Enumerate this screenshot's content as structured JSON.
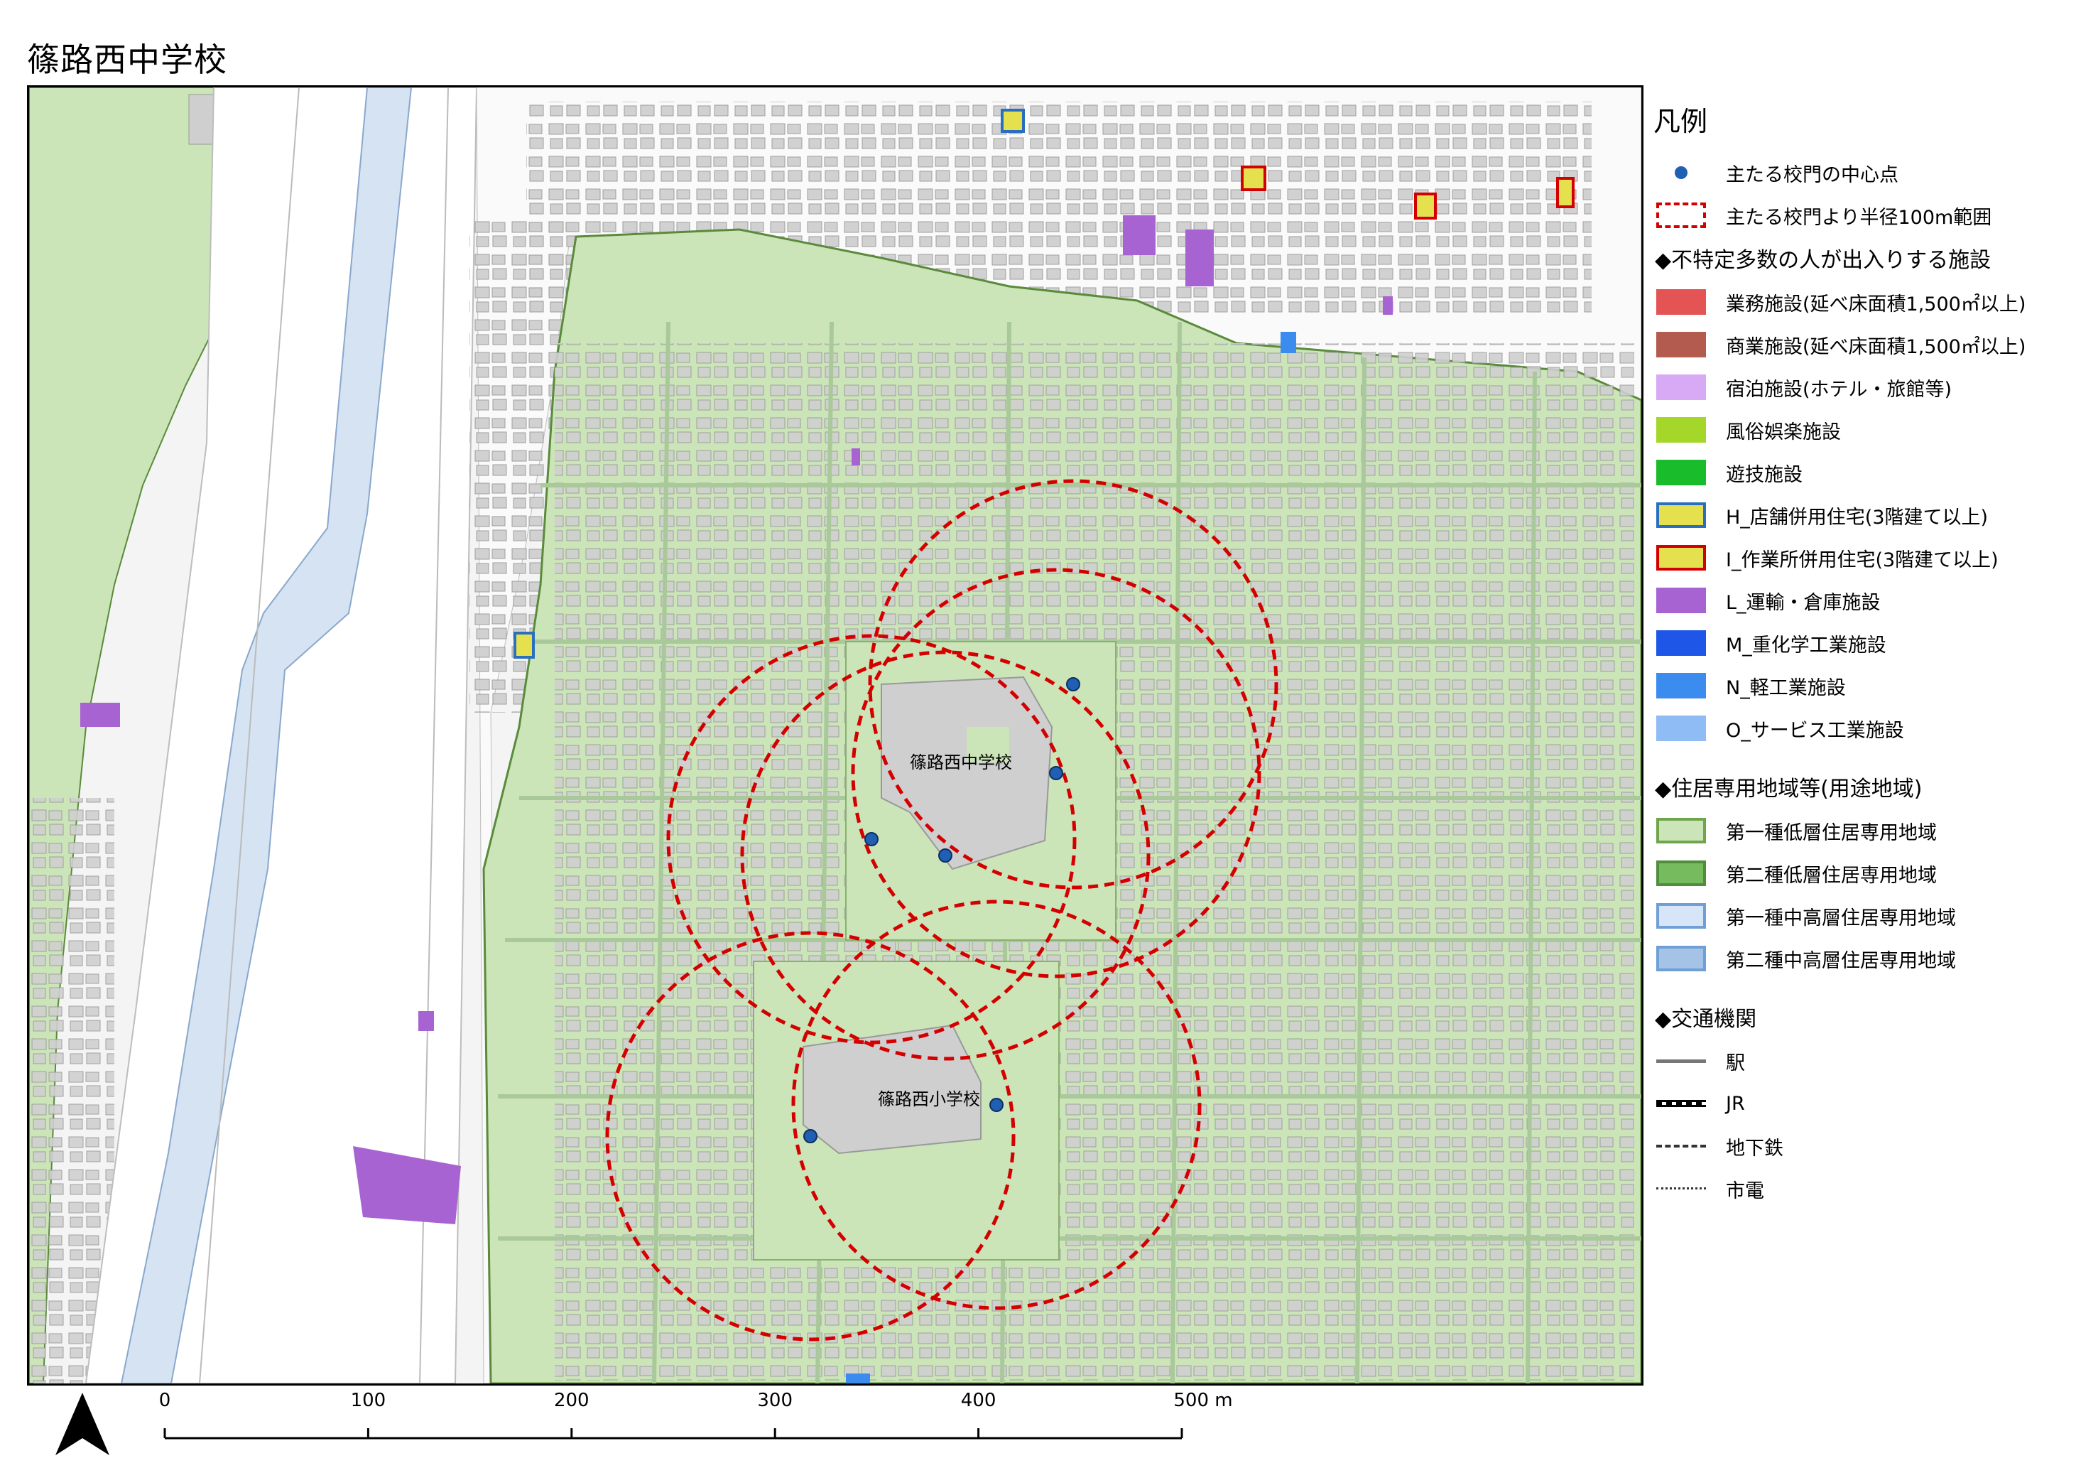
{
  "title": "篠路西中学校",
  "map": {
    "labels": {
      "middle_school": "篠路西中学校",
      "elementary_school": "篠路西小学校"
    },
    "gates": [
      {
        "school": "篠路西中学校",
        "count": 4
      },
      {
        "school": "篠路西小学校",
        "count": 2
      }
    ],
    "radius_m": 100
  },
  "legend": {
    "title": "凡例",
    "items_top": [
      {
        "label": "主たる校門の中心点",
        "symbol": "dot",
        "color": "#1f5fb4"
      },
      {
        "label": "主たる校門より半径100m範囲",
        "symbol": "dashed-rect",
        "color": "#d40000"
      }
    ],
    "facilities_header": "◆不特定多数の人が出入りする施設",
    "facilities": [
      {
        "label": "業務施設(延べ床面積1,500㎡以上)",
        "fill": "#e45454",
        "stroke": "#e45454"
      },
      {
        "label": "商業施設(延べ床面積1,500㎡以上)",
        "fill": "#b35b4f",
        "stroke": "#b35b4f"
      },
      {
        "label": "宿泊施設(ホテル・旅館等)",
        "fill": "#d8a9f4",
        "stroke": "#d8a9f4"
      },
      {
        "label": "風俗娯楽施設",
        "fill": "#a5d62a",
        "stroke": "#a5d62a"
      },
      {
        "label": "遊技施設",
        "fill": "#19bd2b",
        "stroke": "#19bd2b"
      },
      {
        "label": "H_店舗併用住宅(3階建て以上)",
        "fill": "#e4e04e",
        "stroke": "#2a6fbf"
      },
      {
        "label": "I_作業所併用住宅(3階建て以上)",
        "fill": "#e4e04e",
        "stroke": "#d40000"
      },
      {
        "label": "L_運輸・倉庫施設",
        "fill": "#a863d2",
        "stroke": "#a863d2"
      },
      {
        "label": "M_重化学工業施設",
        "fill": "#1e56e8",
        "stroke": "#1e56e8"
      },
      {
        "label": "N_軽工業施設",
        "fill": "#3c8cef",
        "stroke": "#3c8cef"
      },
      {
        "label": "O_サービス工業施設",
        "fill": "#8fbcf5",
        "stroke": "#8fbcf5"
      }
    ],
    "zones_header": "◆住居専用地域等(用途地域)",
    "zones": [
      {
        "label": "第一種低層住居専用地域",
        "fill": "#cbe5b8",
        "stroke": "#6ea54d"
      },
      {
        "label": "第二種低層住居専用地域",
        "fill": "#76bb5e",
        "stroke": "#4f8e3b"
      },
      {
        "label": "第一種中高層住居専用地域",
        "fill": "#d6e6f8",
        "stroke": "#6f9fd6"
      },
      {
        "label": "第二種中高層住居専用地域",
        "fill": "#a4c3e6",
        "stroke": "#6f9fd6"
      }
    ],
    "transport_header": "◆交通機関",
    "transport": [
      {
        "label": "駅",
        "symbol": "solid-line"
      },
      {
        "label": "JR",
        "symbol": "rail-line"
      },
      {
        "label": "地下鉄",
        "symbol": "dash-line"
      },
      {
        "label": "市電",
        "symbol": "dot-line"
      }
    ]
  },
  "scale_bar": {
    "ticks": [
      "0",
      "100",
      "200",
      "300",
      "400",
      "500 m"
    ]
  },
  "colors": {
    "zone_fill": "#cbe5b8",
    "zone_outline": "#5a8a3c",
    "building": "#cfcfcf",
    "building_outline": "#9a9a9a",
    "river": "#d5e3f2",
    "buffer": "#d40000",
    "gate": "#1f5fb4"
  }
}
